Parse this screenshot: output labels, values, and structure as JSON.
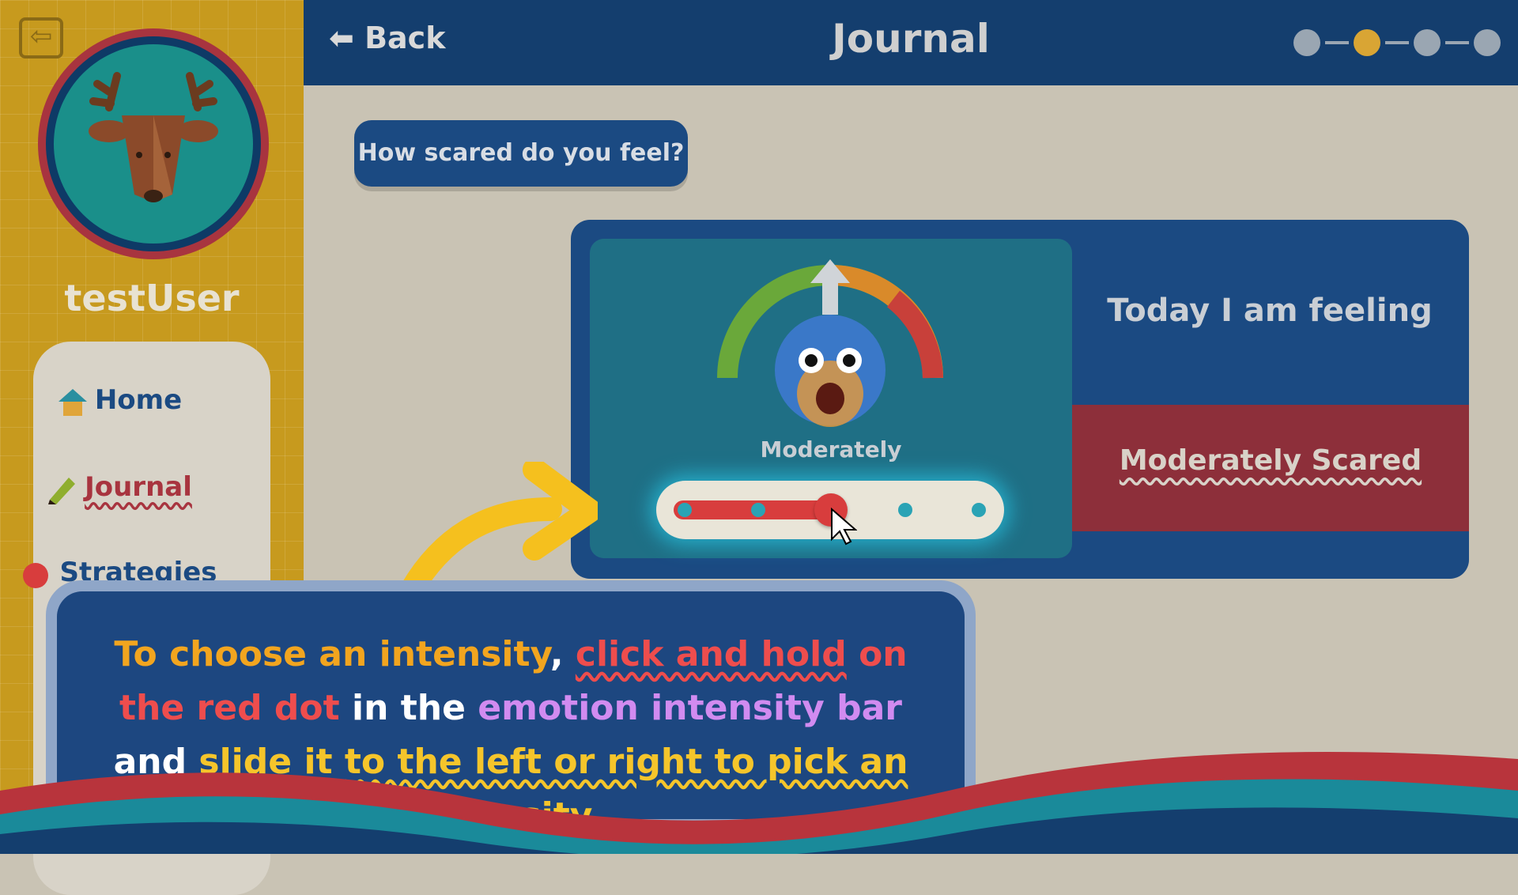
{
  "sidebar": {
    "username": "testUser",
    "nav": [
      {
        "label": "Home",
        "icon": "house-icon"
      },
      {
        "label": "Journal",
        "icon": "pencil-icon"
      },
      {
        "label": "Strategies",
        "icon": "strategies-icon"
      }
    ]
  },
  "header": {
    "back_label": "Back",
    "title": "Journal"
  },
  "prompt": {
    "question": "How scared do you feel?"
  },
  "meter": {
    "level_label": "Moderately",
    "slider": {
      "steps": 5,
      "selected_step": 3
    }
  },
  "feeling": {
    "title": "Today I am feeling",
    "value": "Moderately Scared"
  },
  "tutorial": {
    "part1": "To choose an intensity",
    "part2": ",",
    "part3": "click and hold",
    "part4": "on the",
    "part5": "red dot",
    "part6": "in the",
    "part7": "emotion intensity bar",
    "part8": "and",
    "part9": "slide",
    "part10": "it to the left or right to pick an intensity."
  },
  "colors": {
    "header": "#143e6e",
    "sidebar": "#c79a1e",
    "accent_red": "#d83d3d",
    "tutorial_bg": "#1d4780"
  }
}
